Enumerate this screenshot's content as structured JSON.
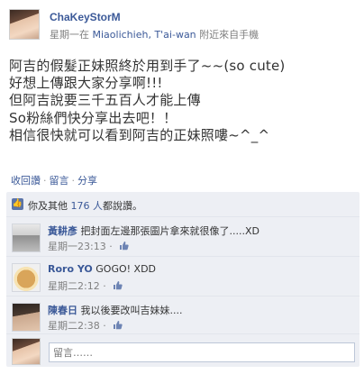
{
  "post": {
    "author": "ChaKeyStorM",
    "meta_prefix": "星期一在",
    "location": "Miaolichieh, T'ai-wan",
    "meta_suffix": "附近來自手機",
    "lines": [
      "阿吉的假髮正妹照終於用到手了~~(so cute)",
      "好想上傳跟大家分享啊!!!",
      "但阿吉說要三千五百人才能上傳",
      "So粉絲們快分享出去吧！！",
      "相信很快就可以看到阿吉的正妹照嘍~^_^"
    ]
  },
  "actions": {
    "unlike": "收回讚",
    "comment": "留言",
    "share": "分享",
    "separator": "·"
  },
  "likes": {
    "icon": "thumbs-up-icon",
    "prefix": "你及其他",
    "count_link": "176 人",
    "suffix": "都說讚。"
  },
  "comments": [
    {
      "name": "黃耕彥",
      "text": "把封面左邊那張圖片拿來就很像了.....XD",
      "time": "星期一23:13",
      "separator": "·"
    },
    {
      "name": "Roro YO",
      "text": "GOGO! XDD",
      "time": "星期二2:12",
      "separator": "·"
    },
    {
      "name": "陳春日",
      "text": "我以後要改叫吉妹妹....",
      "time": "星期二2:38",
      "separator": "·"
    }
  ],
  "composer": {
    "placeholder": "留言……"
  },
  "colors": {
    "link": "#3b5998",
    "ufi_bg": "#edeff4",
    "muted": "#808080"
  }
}
